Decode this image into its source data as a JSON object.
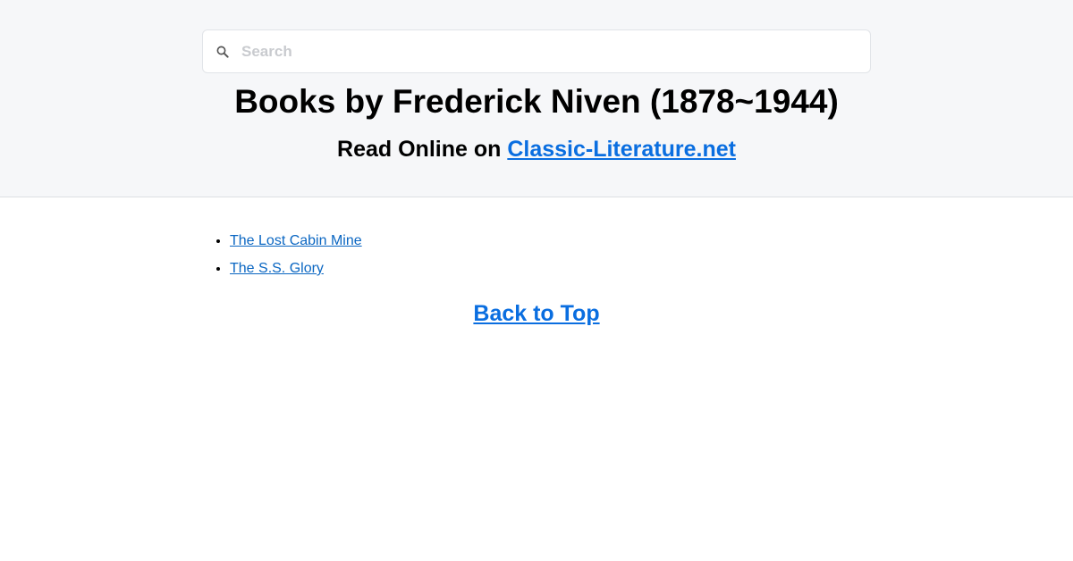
{
  "search": {
    "placeholder": "Search",
    "value": "",
    "icon": "search-icon"
  },
  "header": {
    "title": "Books by Frederick Niven (1878~1944)",
    "subtitle_prefix": "Read Online on ",
    "site_link": "Classic-Literature.net"
  },
  "books": [
    {
      "title": "The Lost Cabin Mine"
    },
    {
      "title": "The S.S. Glory"
    }
  ],
  "footer": {
    "back_to_top": "Back to Top"
  },
  "colors": {
    "header_bg": "#f6f7f9",
    "link": "#0a6ee0",
    "text": "#000000"
  }
}
